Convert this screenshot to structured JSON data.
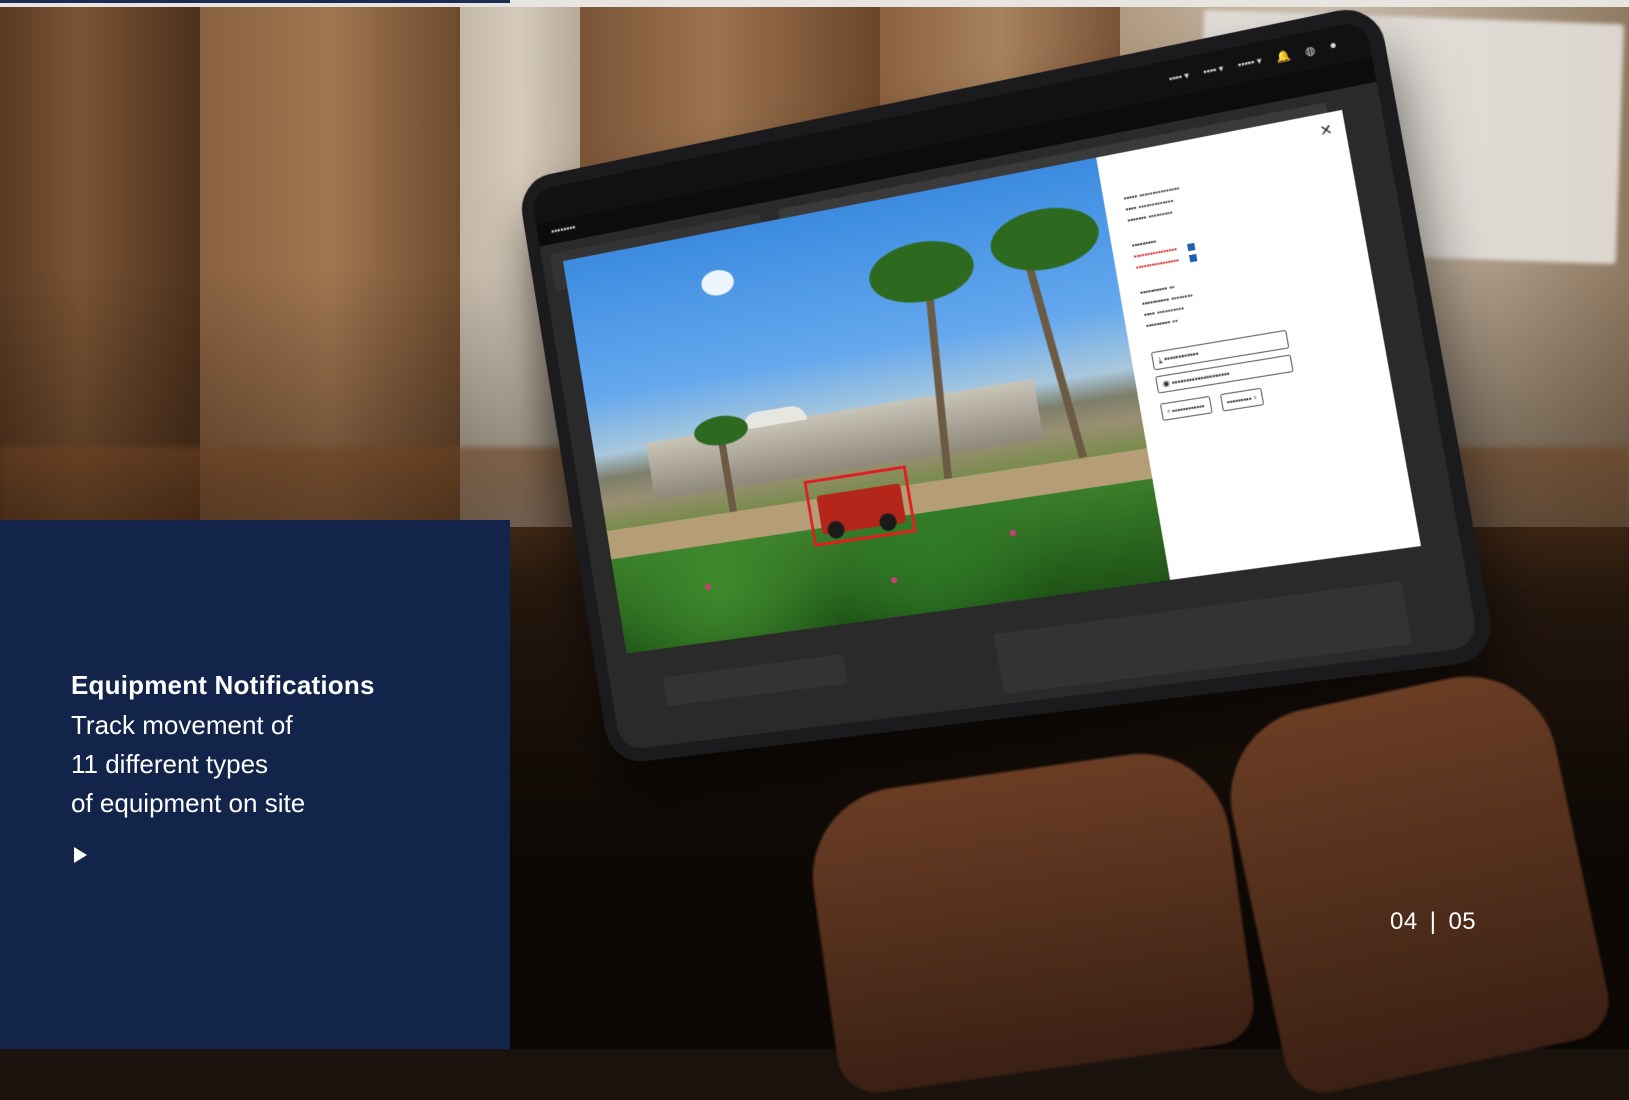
{
  "slide": {
    "title": "Equipment Notifications",
    "lines": [
      "Track movement of",
      "11 different types",
      "of equipment on site"
    ],
    "play_icon": "play-icon",
    "progress": 0.313
  },
  "counter": {
    "current": "04",
    "separator": "|",
    "total": "05"
  },
  "colors": {
    "panel": "#12244a",
    "detection": "#e11d1d"
  }
}
